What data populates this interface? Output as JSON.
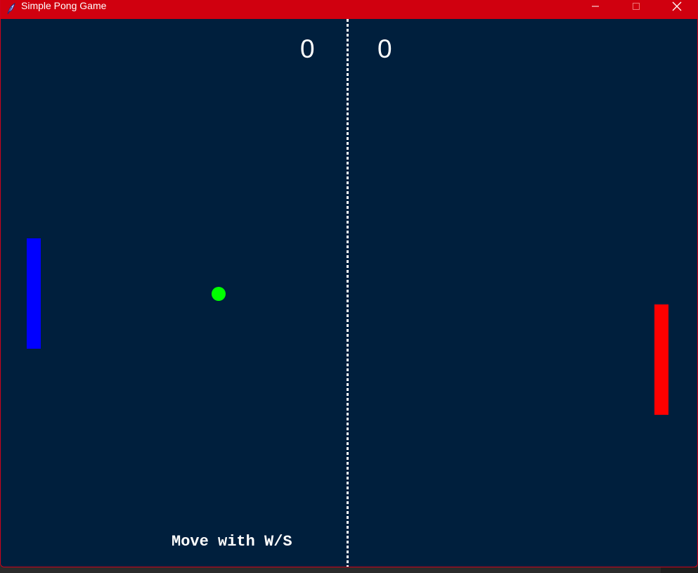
{
  "window": {
    "title": "Simple Pong Game",
    "icon": "feather-icon",
    "controls": {
      "minimize_icon": "minimize-icon",
      "maximize_icon": "maximize-icon",
      "close_icon": "close-icon"
    },
    "titlebar_color": "#d0000f"
  },
  "game": {
    "background_color": "#001f3d",
    "score_left": "0",
    "score_right": "0",
    "hint": "Move with W/S",
    "left_paddle_color": "#0000ff",
    "right_paddle_color": "#ff0000",
    "ball_color": "#00ff00",
    "center_line_color": "#ffffff"
  }
}
